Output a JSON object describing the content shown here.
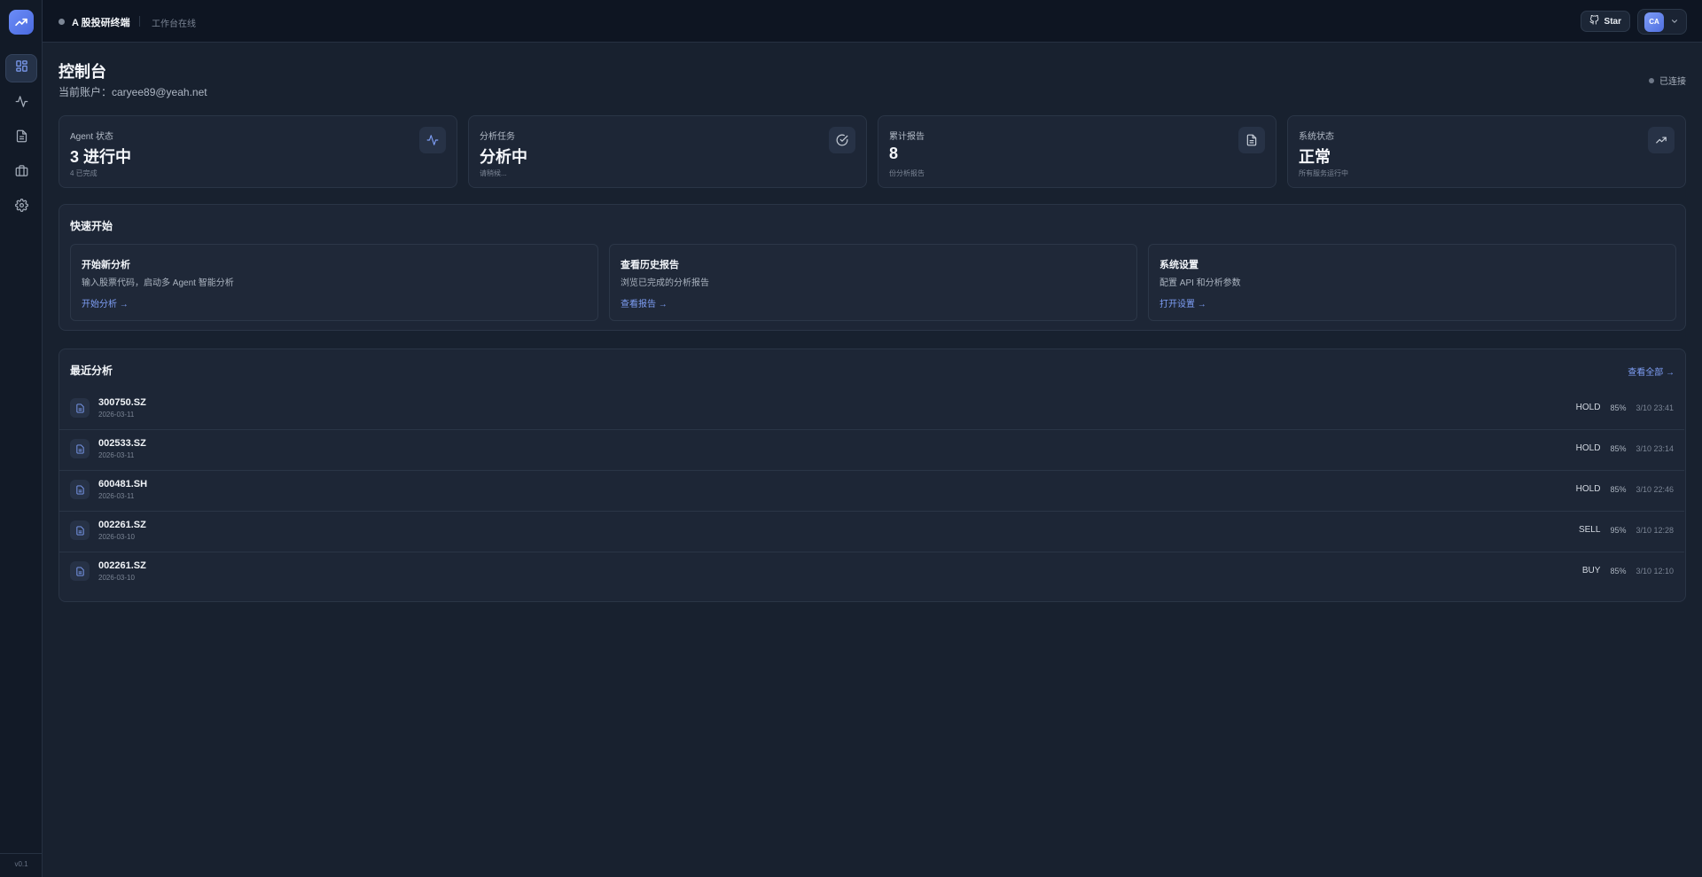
{
  "app": {
    "brand": "A 股投研终端",
    "status": "工作台在线",
    "star_label": "Star",
    "user_initials": "CA",
    "version": "v0.1"
  },
  "sidebar": {
    "items": [
      {
        "icon": "dashboard-icon",
        "active": true
      },
      {
        "icon": "activity-icon",
        "active": false
      },
      {
        "icon": "document-icon",
        "active": false
      },
      {
        "icon": "briefcase-icon",
        "active": false
      },
      {
        "icon": "gear-icon",
        "active": false
      }
    ]
  },
  "header": {
    "title": "控制台",
    "account": "当前账户：caryee89@yeah.net",
    "connection": "已连接"
  },
  "stats": [
    {
      "label": "Agent 状态",
      "value": "3 进行中",
      "sub": "4 已完成",
      "icon": "activity-icon"
    },
    {
      "label": "分析任务",
      "value": "分析中",
      "sub": "请稍候...",
      "icon": "check-circle-icon"
    },
    {
      "label": "累计报告",
      "value": "8",
      "sub": "份分析报告",
      "icon": "document-icon"
    },
    {
      "label": "系统状态",
      "value": "正常",
      "sub": "所有服务运行中",
      "icon": "trending-up-icon"
    }
  ],
  "quick_start": {
    "title": "快速开始",
    "items": [
      {
        "title": "开始新分析",
        "desc": "输入股票代码，启动多 Agent 智能分析",
        "link": "开始分析 →"
      },
      {
        "title": "查看历史报告",
        "desc": "浏览已完成的分析报告",
        "link": "查看报告 →"
      },
      {
        "title": "系统设置",
        "desc": "配置 API 和分析参数",
        "link": "打开设置 →"
      }
    ]
  },
  "recent": {
    "title": "最近分析",
    "view_all": "查看全部 →",
    "rows": [
      {
        "code": "300750.SZ",
        "date": "2026-03-11",
        "rating": "HOLD",
        "confidence": "85%",
        "time": "3/10 23:41"
      },
      {
        "code": "002533.SZ",
        "date": "2026-03-11",
        "rating": "HOLD",
        "confidence": "85%",
        "time": "3/10 23:14"
      },
      {
        "code": "600481.SH",
        "date": "2026-03-11",
        "rating": "HOLD",
        "confidence": "85%",
        "time": "3/10 22:46"
      },
      {
        "code": "002261.SZ",
        "date": "2026-03-10",
        "rating": "SELL",
        "confidence": "95%",
        "time": "3/10 12:28"
      },
      {
        "code": "002261.SZ",
        "date": "2026-03-10",
        "rating": "BUY",
        "confidence": "85%",
        "time": "3/10 12:10"
      }
    ]
  }
}
